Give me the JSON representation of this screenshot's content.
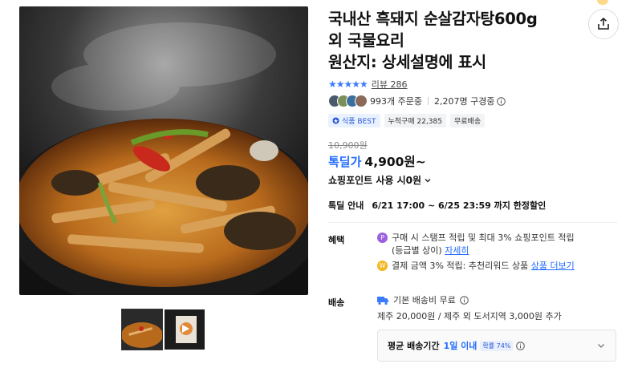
{
  "product": {
    "title_line1": "국내산 흑돼지 순살감자탕600g",
    "title_line2": "외 국물요리",
    "title_line3": "원산지: 상세설명에 표시"
  },
  "rating": {
    "stars": "★★★★★",
    "review_label": "리뷰 286"
  },
  "stats": {
    "orders": "993개 주문중",
    "wishlist": "2,207명 구경중"
  },
  "badges": {
    "best": "식품 BEST",
    "cumulative": "누적구매 22,385",
    "free_ship": "무료배송"
  },
  "price": {
    "original": "10,900원",
    "deal_tag": "톡딜가",
    "deal_price": "4,900원~"
  },
  "points": {
    "label": "쇼핑포인트 사용 시0원"
  },
  "deal_notice": {
    "key": "톡딜 안내",
    "value": "6/21 17:00 ~ 6/25 23:59 까지 한정할인"
  },
  "benefit": {
    "label": "혜택",
    "line1": "구매 시 스탬프 적립 및 최대 3% 쇼핑포인트 적립",
    "line2_prefix": "(등급별 상이)",
    "line2_link": "자세히",
    "line3_prefix": "결제 금액 3% 적립: 추천리워드 상품",
    "line3_link": "상품 더보기"
  },
  "shipping": {
    "label": "배송",
    "basic": "기본 배송비 무료",
    "extra": "제주 20,000원 / 제주 외 도서지역 3,000원 추가",
    "avg_label": "평균 배송기간",
    "avg_value": "1일 이내",
    "prob": "확률 74%"
  },
  "colors": {
    "accent": "#1f6bff",
    "star": "#3a7bfd"
  }
}
